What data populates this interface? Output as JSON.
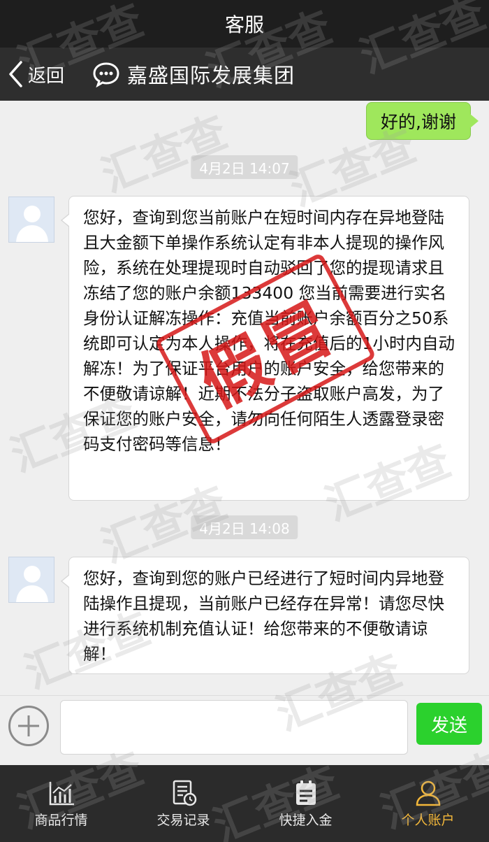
{
  "status_bar": {
    "title": "客服"
  },
  "nav": {
    "back_label": "返回",
    "chat_title": "嘉盛国际发展集团"
  },
  "messages": {
    "outgoing_1": "好的,谢谢",
    "timestamp_1": "4月2日 14:07",
    "incoming_1": "您好，查询到您当前账户在短时间内存在异地登陆且大金额下单操作系统认定有非本人提现的操作风险，系统在处理提现时自动驳回了您的提现请求且冻结了您的账户余额133400 您当前需要进行实名身份认证解冻操作：充值当前账户余额百分之50系统即可认定为本人操作，将在充值后的1小时内自动解冻！为了保证平台用户的账户安全，给您带来的不便敬请谅解！近期不法分子盗取账户高发，为了保证您的账户安全，请勿向任何陌生人透露登录密码支付密码等信息！",
    "timestamp_2": "4月2日 14:08",
    "incoming_2": "您好，查询到您的账户已经进行了短时间内异地登陆操作且提现，当前账户已经存在异常！请您尽快进行系统机制充值认证！给您带来的不便敬请谅解！"
  },
  "stamp_text": "假冒",
  "watermark_text": "汇查查",
  "input": {
    "value": "",
    "send_label": "发送"
  },
  "tabs": [
    {
      "label": "商品行情",
      "icon": "chart-icon",
      "active": false
    },
    {
      "label": "交易记录",
      "icon": "record-icon",
      "active": false
    },
    {
      "label": "快捷入金",
      "icon": "deposit-icon",
      "active": false
    },
    {
      "label": "个人账户",
      "icon": "user-icon",
      "active": true
    }
  ],
  "colors": {
    "status_bar_bg": "#1e1e1e",
    "nav_bg": "#2e2e2e",
    "outgoing_bubble": "#9fe75c",
    "send_button": "#2bd12d",
    "stamp": "#d61818",
    "active_tab": "#f3b73a"
  }
}
